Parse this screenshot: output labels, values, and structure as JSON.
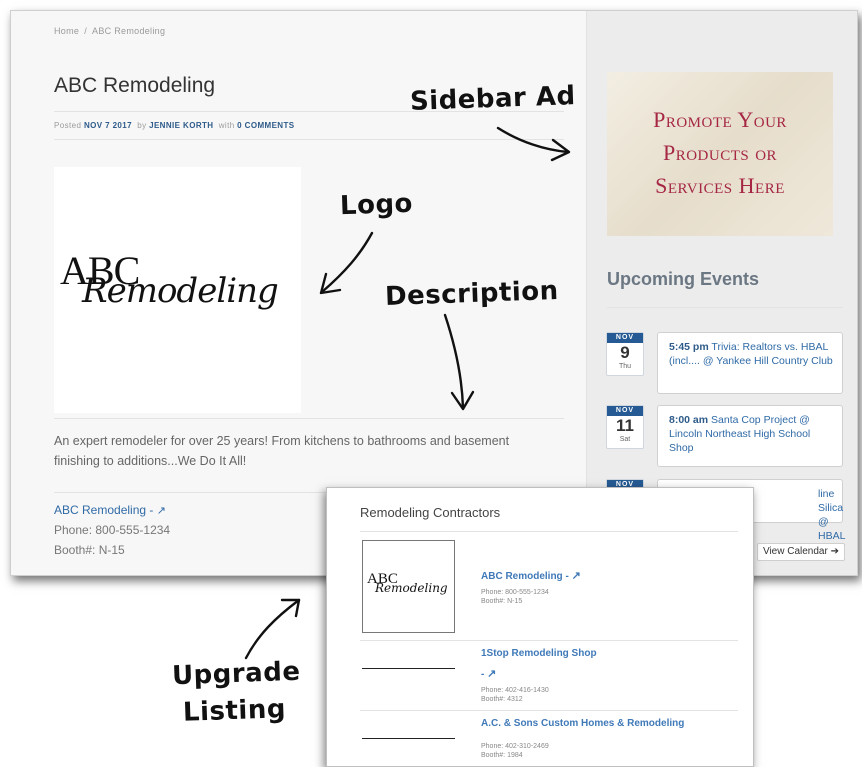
{
  "breadcrumb": {
    "home": "Home",
    "separator": "/",
    "current": "ABC Remodeling"
  },
  "post": {
    "title": "ABC Remodeling",
    "meta_posted": "Posted",
    "meta_date": "NOV 7 2017",
    "meta_by": "by",
    "meta_author": "JENNIE KORTH",
    "meta_with": "with",
    "meta_comments": "0 COMMENTS",
    "logo_text_1": "ABC",
    "logo_text_2": "Remodeling",
    "description": "An expert remodeler for over 25 years! From kitchens to bathrooms and basement finishing to additions...We Do It All!",
    "listing_name": "ABC Remodeling -",
    "listing_phone": "Phone: 800-555-1234",
    "listing_booth": "Booth#: N-15"
  },
  "sidebar": {
    "ad_line_1": "Promote Your",
    "ad_line_2": "Products or",
    "ad_line_3": "Services Here",
    "events_title": "Upcoming Events",
    "events": [
      {
        "month": "NOV",
        "day": "9",
        "dow": "Thu",
        "time": "5:45 pm",
        "text": "Trivia: Realtors vs. HBAL (incl.... @ Yankee Hill Country Club"
      },
      {
        "month": "NOV",
        "day": "11",
        "dow": "Sat",
        "time": "8:00 am",
        "text": "Santa Cop Project @ Lincoln Northeast High School Shop"
      },
      {
        "month": "NOV",
        "day": "",
        "dow": "",
        "time": "",
        "text": "line Silica @ HBAL"
      }
    ],
    "view_calendar": "View Calendar"
  },
  "inset": {
    "title": "Remodeling Contractors",
    "logo_text_1": "ABC",
    "logo_text_2": "Remodeling",
    "items": [
      {
        "name": "ABC Remodeling -",
        "phone": "Phone: 800-555-1234",
        "booth": "Booth#: N-15"
      },
      {
        "name": "1Stop Remodeling Shop",
        "name_suffix": "-",
        "phone": "Phone: 402-416-1430",
        "booth": "Booth#: 4312"
      },
      {
        "name": "A.C. & Sons Custom Homes & Remodeling",
        "phone": "Phone: 402-310-2469",
        "booth": "Booth#: 1984"
      }
    ]
  },
  "annotations": {
    "sidebar_ad": "Sidebar Ad",
    "logo": "Logo",
    "description": "Description",
    "upgrade_1": "Upgrade",
    "upgrade_2": "Listing"
  },
  "colors": {
    "link": "#2f6aa6",
    "ad_text": "#a52744",
    "date_header": "#255a94"
  }
}
